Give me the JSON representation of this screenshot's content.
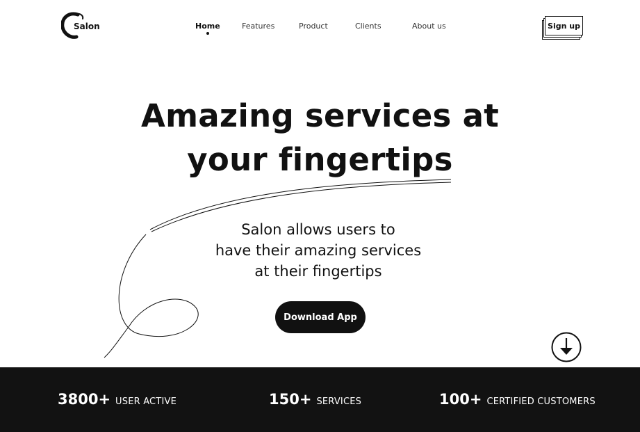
{
  "brand": {
    "name": "Salon"
  },
  "nav": {
    "items": [
      {
        "label": "Home",
        "active": true
      },
      {
        "label": "Features",
        "active": false
      },
      {
        "label": "Product",
        "active": false
      },
      {
        "label": "Clients",
        "active": false
      },
      {
        "label": "About us",
        "active": false
      }
    ]
  },
  "header": {
    "signup_label": "Sign up"
  },
  "hero": {
    "title_line1": "Amazing services at",
    "title_line2": "your fingertips",
    "subtitle_line1": "Salon allows users to",
    "subtitle_line2": "have their amazing services",
    "subtitle_line3": "at their fingertips",
    "cta_label": "Download App"
  },
  "stats": [
    {
      "value": "3800+",
      "label": "USER ACTIVE"
    },
    {
      "value": "150+",
      "label": "SERVICES"
    },
    {
      "value": "100+",
      "label": "CERTIFIED CUSTOMERS"
    }
  ],
  "icons": {
    "logo": "salon-logo-swirl-icon",
    "scroll": "arrow-down-circle-icon"
  },
  "colors": {
    "primary": "#111111",
    "background": "#ffffff",
    "stats_bar": "#121212",
    "on_dark": "#ffffff"
  }
}
